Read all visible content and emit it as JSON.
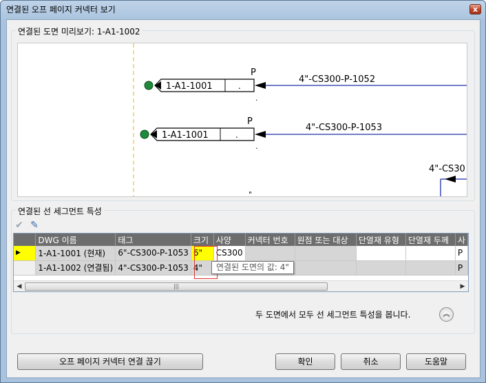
{
  "window": {
    "title": "연결된 오프 페이지 커넥터 보기",
    "close_glyph": "x"
  },
  "preview_group": {
    "title": "연결된 도면 미리보기: 1-A1-1002",
    "connectors": [
      {
        "tag": "1-A1-1001",
        "mark": "P",
        "line_label": "4\"-CS300-P-1052"
      },
      {
        "tag": "1-A1-1001",
        "mark": "P",
        "line_label": "4\"-CS300-P-1053"
      }
    ],
    "partial_label": "4\"-CS30",
    "dot_char": ".",
    "tick_char": "\""
  },
  "segment_group": {
    "title": "연결된 선 세그먼트 특성",
    "columns": [
      "DWG 이름",
      "태그",
      "크기",
      "사양",
      "커넥터 번호",
      "원점 또는 대상",
      "단열재 유형",
      "단열재 두께",
      "사"
    ],
    "rows": [
      {
        "marker": "▶",
        "dwg": "1-A1-1001 (현재)",
        "tag": "6\"-CS300-P-1053",
        "size": "6\"",
        "spec": "CS300",
        "connector": "",
        "origin": "",
        "ins_type": "",
        "ins_thick": "",
        "extra": "P"
      },
      {
        "marker": "",
        "dwg": "1-A1-1002 (연결됨)",
        "tag": "4\"-CS300-P-1053",
        "size": "4\"",
        "spec": "",
        "connector": "",
        "origin": "",
        "ins_type": "",
        "ins_thick": "",
        "extra": "P"
      }
    ],
    "tooltip": "연결된 도면의 값: 4\"",
    "scroll_left": "◀",
    "scroll_right": "▶",
    "scroll_thumb": "|||",
    "info_text": "두 도면에서 모두 선 세그먼트 특성을 봅니다.",
    "collapse_glyph": "︽"
  },
  "buttons": {
    "disconnect": "오프 페이지 커넥터 연결 끊기",
    "ok": "확인",
    "cancel": "취소",
    "help": "도움말"
  },
  "colors": {
    "pipe_line": "#1a2fa8",
    "badge_green": "#1e8a3a",
    "current_row_marker": "#ffff00"
  }
}
